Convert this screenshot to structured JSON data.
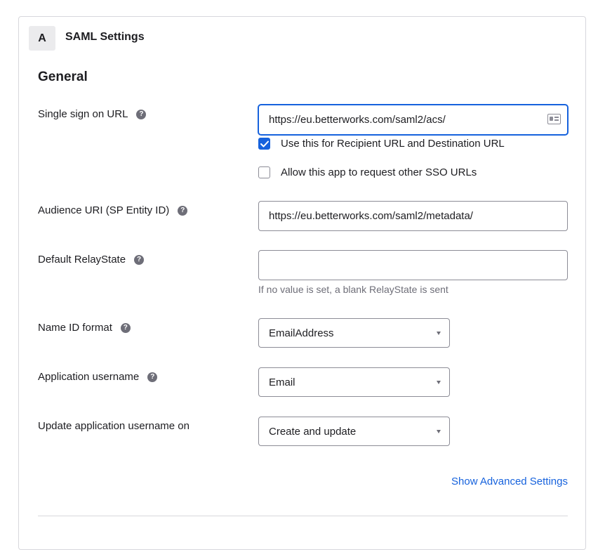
{
  "panel": {
    "step_badge": "A",
    "title": "SAML Settings"
  },
  "section": {
    "title": "General"
  },
  "fields": {
    "sso_url": {
      "label": "Single sign on URL",
      "value": "https://eu.betterworks.com/saml2/acs/"
    },
    "recipient_checkbox": {
      "label": "Use this for Recipient URL and Destination URL",
      "checked": true
    },
    "other_sso_checkbox": {
      "label": "Allow this app to request other SSO URLs",
      "checked": false
    },
    "audience_uri": {
      "label": "Audience URI (SP Entity ID)",
      "value": "https://eu.betterworks.com/saml2/metadata/"
    },
    "relay_state": {
      "label": "Default RelayState",
      "value": "",
      "hint": "If no value is set, a blank RelayState is sent"
    },
    "name_id_format": {
      "label": "Name ID format",
      "selected": "EmailAddress"
    },
    "app_username": {
      "label": "Application username",
      "selected": "Email"
    },
    "update_username_on": {
      "label": "Update application username on",
      "selected": "Create and update"
    }
  },
  "advanced_link": "Show Advanced Settings",
  "icons": {
    "help": "question-mark-icon",
    "card": "contact-card-icon",
    "check": "checkmark-icon",
    "caret": "caret-down-icon"
  },
  "colors": {
    "accent": "#1662dd",
    "border": "#8c8c96",
    "muted_text": "#6e6e78"
  }
}
